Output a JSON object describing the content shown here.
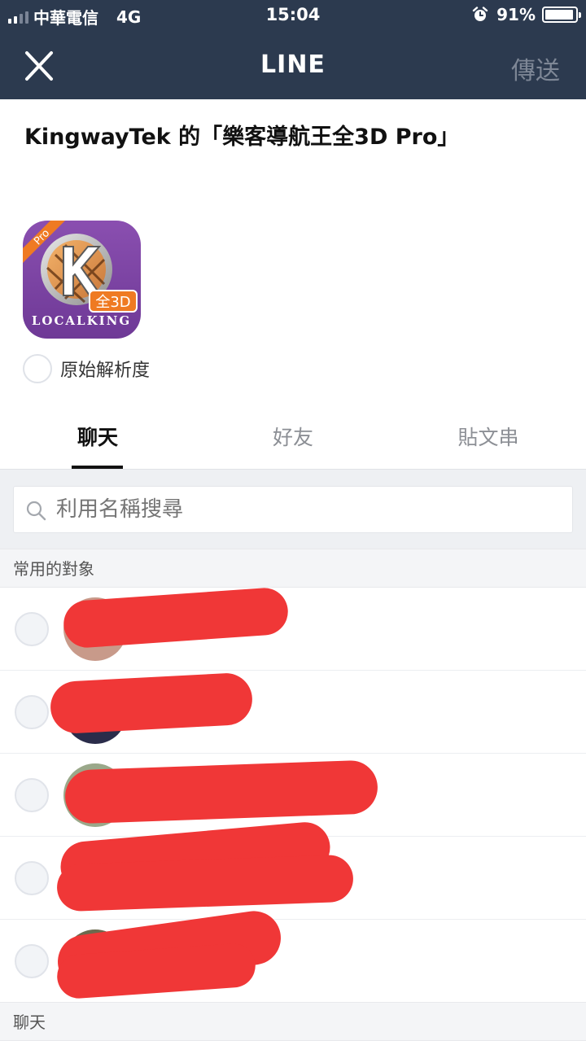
{
  "status_bar": {
    "carrier": "中華電信",
    "network": "4G",
    "time": "15:04",
    "battery": "91%"
  },
  "nav": {
    "title": "LINE",
    "send_label": "傳送",
    "close_icon": "close-icon"
  },
  "share": {
    "title": "KingwayTek 的「樂客導航王全3D Pro」",
    "app_icon": {
      "badge": "Pro",
      "tag": "全3D",
      "brand": "LOCALKING",
      "letter": "K"
    },
    "original_resolution_label": "原始解析度"
  },
  "tabs": [
    {
      "label": "聊天",
      "active": true
    },
    {
      "label": "好友",
      "active": false
    },
    {
      "label": "貼文串",
      "active": false
    }
  ],
  "search": {
    "placeholder": "利用名稱搜尋"
  },
  "sections": {
    "frequent": "常用的對象",
    "chats": "聊天"
  },
  "colors": {
    "header_bg": "#2c3a4f",
    "accent_text": "#111111",
    "redaction": "#f03737"
  }
}
